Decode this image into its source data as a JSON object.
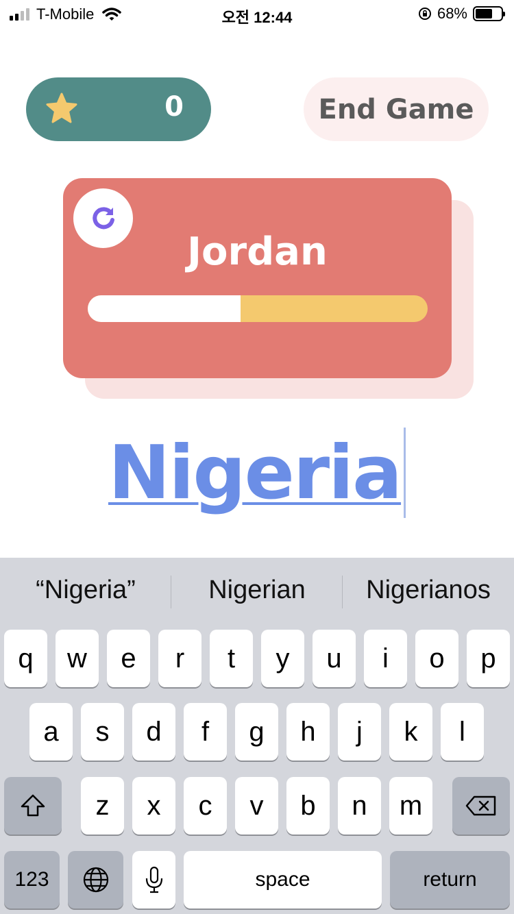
{
  "status_bar": {
    "carrier": "T-Mobile",
    "time": "오전 12:44",
    "battery": "68%",
    "battery_level": 0.68
  },
  "header": {
    "score": "0",
    "end_game_label": "End Game"
  },
  "card": {
    "country": "Jordan",
    "time_remaining_fraction": 0.45
  },
  "answer": {
    "value": "Nigeria"
  },
  "keyboard": {
    "suggestions": [
      "“Nigeria”",
      "Nigerian",
      "Nigerianos"
    ],
    "row1": [
      "q",
      "w",
      "e",
      "r",
      "t",
      "y",
      "u",
      "i",
      "o",
      "p"
    ],
    "row2": [
      "a",
      "s",
      "d",
      "f",
      "g",
      "h",
      "j",
      "k",
      "l"
    ],
    "row3": [
      "z",
      "x",
      "c",
      "v",
      "b",
      "n",
      "m"
    ],
    "numbers_label": "123",
    "space_label": "space",
    "return_label": "return"
  },
  "colors": {
    "score_pill": "#528c88",
    "card": "#e27b73",
    "progress_fill": "#f4c96e",
    "answer_text": "#6b8ee6",
    "refresh_icon": "#7b61e6",
    "star": "#f4c96e"
  },
  "icons": [
    "star-icon",
    "refresh-icon",
    "shift-icon",
    "backspace-icon",
    "globe-icon",
    "microphone-icon",
    "wifi-icon",
    "orientation-lock-icon"
  ]
}
